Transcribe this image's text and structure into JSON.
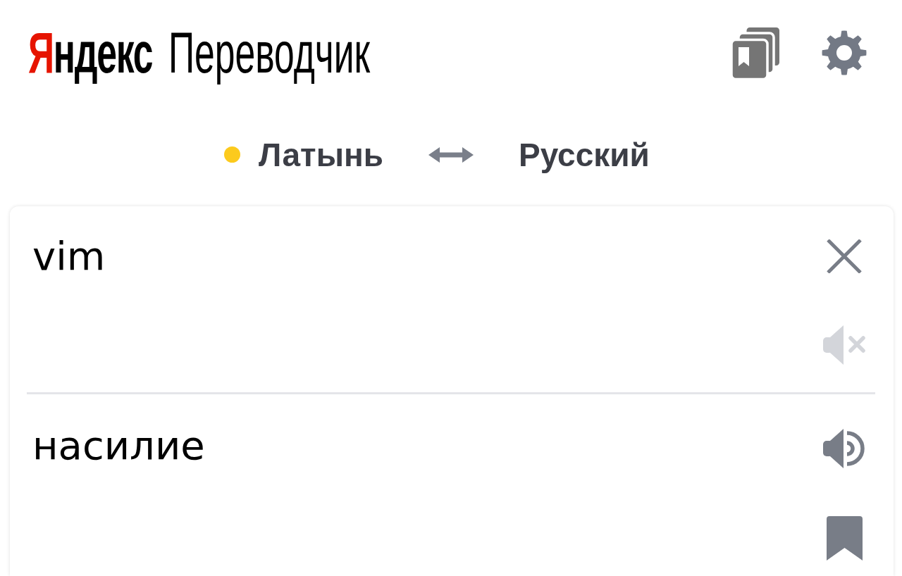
{
  "header": {
    "brand": "Яндекс",
    "product": "Переводчик"
  },
  "languages": [
    {
      "label": "Латынь",
      "dot": true
    },
    {
      "label": "Русский",
      "dot": false
    }
  ],
  "source": {
    "text": "vim",
    "speaker": {
      "disabled": true
    }
  },
  "translation": {
    "text": "насилие",
    "speaker": {
      "disabled": false
    }
  }
}
